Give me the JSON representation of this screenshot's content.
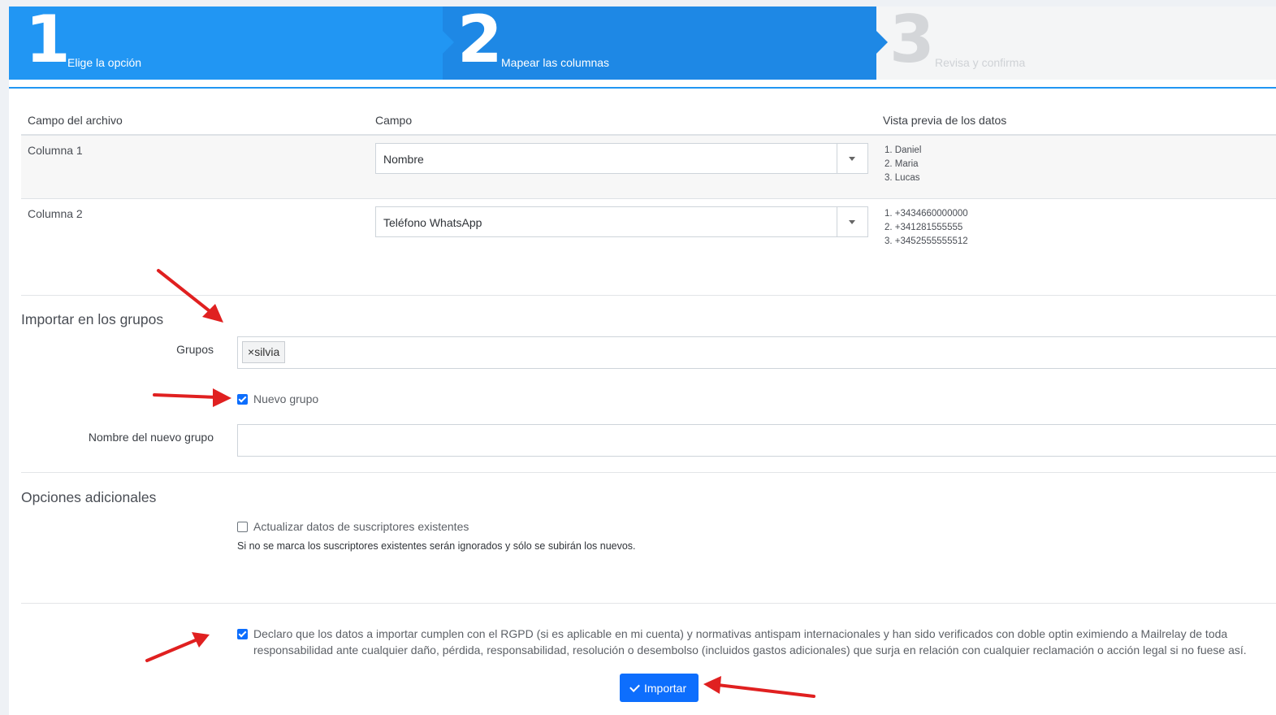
{
  "wizard": {
    "steps": [
      {
        "number": "1",
        "label": "Elige la opción"
      },
      {
        "number": "2",
        "label": "Mapear las columnas"
      },
      {
        "number": "3",
        "label": "Revisa y confirma"
      }
    ],
    "active_step": 2
  },
  "mapping": {
    "headers": [
      "Campo del archivo",
      "Campo",
      "Vista previa de los datos"
    ],
    "rows": [
      {
        "column": "Columna 1",
        "field": "Nombre",
        "preview": [
          "1. Daniel",
          "2. Maria",
          "3. Lucas"
        ]
      },
      {
        "column": "Columna 2",
        "field": "Teléfono WhatsApp",
        "preview": [
          "1. +3434660000000",
          "2. +341281555555",
          "3. +3452555555512"
        ]
      }
    ]
  },
  "groups": {
    "title": "Importar en los grupos",
    "groups_label": "Grupos",
    "tags": [
      "silvia"
    ],
    "tag_remove": "×",
    "new_group_label": "Nuevo grupo",
    "new_group_checked": true,
    "new_group_name_label": "Nombre del nuevo grupo",
    "new_group_name_value": ""
  },
  "options": {
    "title": "Opciones adicionales",
    "update_label": "Actualizar datos de suscriptores existentes",
    "update_checked": false,
    "update_hint": "Si no se marca los suscriptores existentes serán ignorados y sólo se subirán los nuevos."
  },
  "rgpd": {
    "checked": true,
    "text": "Declaro que los datos a importar cumplen con el RGPD (si es aplicable en mi cuenta) y normativas antispam internacionales y han sido verificados con doble optin eximiendo a Mailrelay de toda responsabilidad ante cualquier daño, pérdida, responsabilidad, resolución o desembolso (incluidos gastos adicionales) que surja en relación con cualquier reclamación o acción legal si no fuese así."
  },
  "import_button": {
    "label": "Importar",
    "icon": "check-icon"
  },
  "colors": {
    "primary": "#2196f3",
    "step_active": "#1e88e5",
    "button": "#0d6efd",
    "annotation_arrow": "#e02020"
  }
}
